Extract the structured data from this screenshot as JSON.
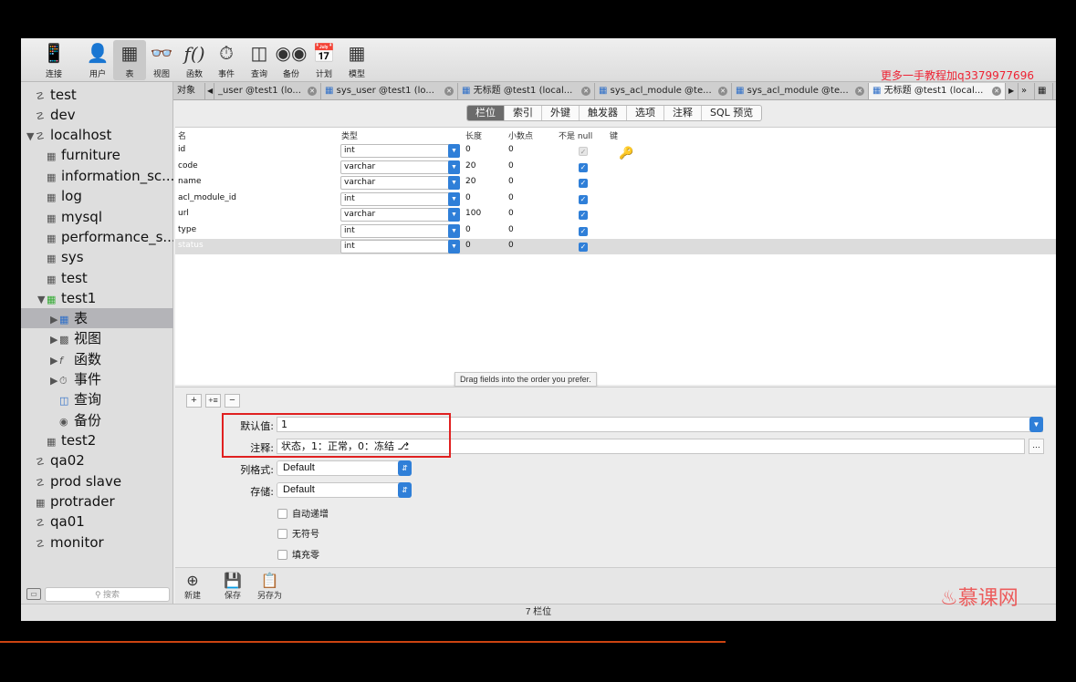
{
  "toolbar": {
    "items": [
      {
        "label": "连接",
        "icon": "connect-icon"
      },
      {
        "label": "用户",
        "icon": "user-icon"
      },
      {
        "label": "表",
        "icon": "table-icon"
      },
      {
        "label": "视图",
        "icon": "view-icon"
      },
      {
        "label": "函数",
        "icon": "function-icon"
      },
      {
        "label": "事件",
        "icon": "event-icon"
      },
      {
        "label": "查询",
        "icon": "query-icon"
      },
      {
        "label": "备份",
        "icon": "backup-icon"
      },
      {
        "label": "计划",
        "icon": "schedule-icon"
      },
      {
        "label": "模型",
        "icon": "model-icon"
      }
    ],
    "watermark": "更多一手教程加q3379977696"
  },
  "sidebar": {
    "items": [
      {
        "label": "test",
        "icon": "connection-icon"
      },
      {
        "label": "dev",
        "icon": "connection-icon"
      },
      {
        "label": "localhost",
        "icon": "connection-icon"
      },
      {
        "label": "furniture",
        "icon": "database-icon"
      },
      {
        "label": "information_sc...",
        "icon": "database-icon"
      },
      {
        "label": "log",
        "icon": "database-icon"
      },
      {
        "label": "mysql",
        "icon": "database-icon"
      },
      {
        "label": "performance_s...",
        "icon": "database-icon"
      },
      {
        "label": "sys",
        "icon": "database-icon"
      },
      {
        "label": "test",
        "icon": "database-icon"
      },
      {
        "label": "test1",
        "icon": "database-icon"
      },
      {
        "label": "表",
        "icon": "table-icon"
      },
      {
        "label": "视图",
        "icon": "view-icon"
      },
      {
        "label": "函数",
        "icon": "function-icon"
      },
      {
        "label": "事件",
        "icon": "event-icon"
      },
      {
        "label": "查询",
        "icon": "query-icon"
      },
      {
        "label": "备份",
        "icon": "backup-icon"
      },
      {
        "label": "test2",
        "icon": "database-icon"
      },
      {
        "label": "qa02",
        "icon": "connection-icon"
      },
      {
        "label": "prod slave",
        "icon": "connection-icon"
      },
      {
        "label": "protrader",
        "icon": "connection-icon"
      },
      {
        "label": "qa01",
        "icon": "connection-icon"
      },
      {
        "label": "monitor",
        "icon": "connection-icon"
      }
    ],
    "search_placeholder": "搜索"
  },
  "tabs": {
    "object_label": "对象",
    "items": [
      {
        "label": "_user @test1 (lo..."
      },
      {
        "label": "sys_user @test1 (lo..."
      },
      {
        "label": "无标题 @test1 (local..."
      },
      {
        "label": "sys_acl_module @te..."
      },
      {
        "label": "sys_acl_module @te..."
      },
      {
        "label": "无标题 @test1 (local..."
      }
    ]
  },
  "segments": [
    "栏位",
    "索引",
    "外键",
    "触发器",
    "选项",
    "注释",
    "SQL 预览"
  ],
  "grid": {
    "headers": {
      "name": "名",
      "type": "类型",
      "length": "长度",
      "decimals": "小数点",
      "not_null": "不是 null",
      "key": "键"
    },
    "rows": [
      {
        "name": "id",
        "type": "int",
        "length": "0",
        "decimals": "0"
      },
      {
        "name": "code",
        "type": "varchar",
        "length": "20",
        "decimals": "0"
      },
      {
        "name": "name",
        "type": "varchar",
        "length": "20",
        "decimals": "0"
      },
      {
        "name": "acl_module_id",
        "type": "int",
        "length": "0",
        "decimals": "0"
      },
      {
        "name": "url",
        "type": "varchar",
        "length": "100",
        "decimals": "0"
      },
      {
        "name": "type",
        "type": "int",
        "length": "0",
        "decimals": "0"
      },
      {
        "name": "status",
        "type": "int",
        "length": "0",
        "decimals": "0"
      }
    ],
    "drag_tip": "Drag fields into the order you prefer."
  },
  "props": {
    "default_label": "默认值:",
    "default_value": "1",
    "comment_label": "注释:",
    "comment_value": "状态，1：正常，0：冻结",
    "format_label": "列格式:",
    "format_value": "Default",
    "storage_label": "存储:",
    "storage_value": "Default",
    "checks": [
      "自动递增",
      "无符号",
      "填充零"
    ]
  },
  "footer": {
    "new_label": "新建",
    "save_label": "保存",
    "saveas_label": "另存为"
  },
  "status": "7 栏位",
  "brand": "慕课网"
}
